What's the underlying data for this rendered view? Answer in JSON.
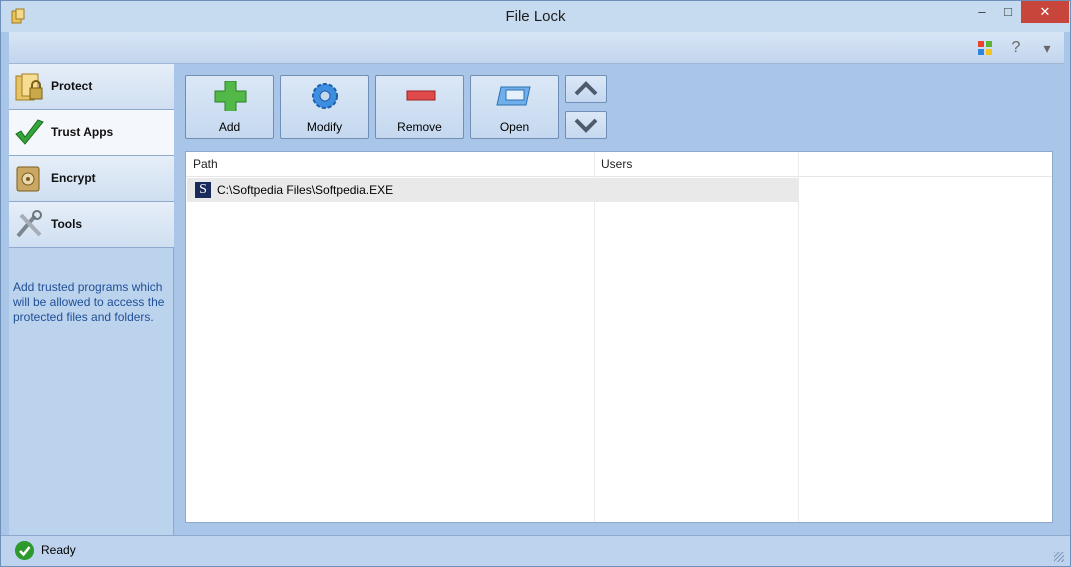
{
  "window": {
    "title": "File Lock",
    "minimize": "–",
    "maximize": "□",
    "close": "✕"
  },
  "ribbon": {
    "icons": [
      "windows-logo-icon",
      "help-icon",
      "dropdown-icon"
    ],
    "help_glyph": "?",
    "dropdown_glyph": "▾"
  },
  "sidebar": {
    "items": [
      {
        "label": "Protect",
        "icon": "folder-lock-icon"
      },
      {
        "label": "Trust Apps",
        "icon": "checkmark-icon"
      },
      {
        "label": "Encrypt",
        "icon": "safe-icon"
      },
      {
        "label": "Tools",
        "icon": "tools-icon"
      }
    ],
    "active": "Trust Apps",
    "hint": "Add trusted programs which will be allowed to access the protected files and folders."
  },
  "toolbar": {
    "add_label": "Add",
    "modify_label": "Modify",
    "remove_label": "Remove",
    "open_label": "Open"
  },
  "grid": {
    "columns": [
      "Path",
      "Users"
    ],
    "rows": [
      {
        "icon": "S",
        "path": "C:\\Softpedia Files\\Softpedia.EXE",
        "users": ""
      }
    ]
  },
  "status": {
    "text": "Ready"
  },
  "colors": {
    "accent": "#a9c6e8",
    "close_button": "#c7453a",
    "ok_green": "#2e9a2e",
    "hint_text": "#1f4f95"
  }
}
